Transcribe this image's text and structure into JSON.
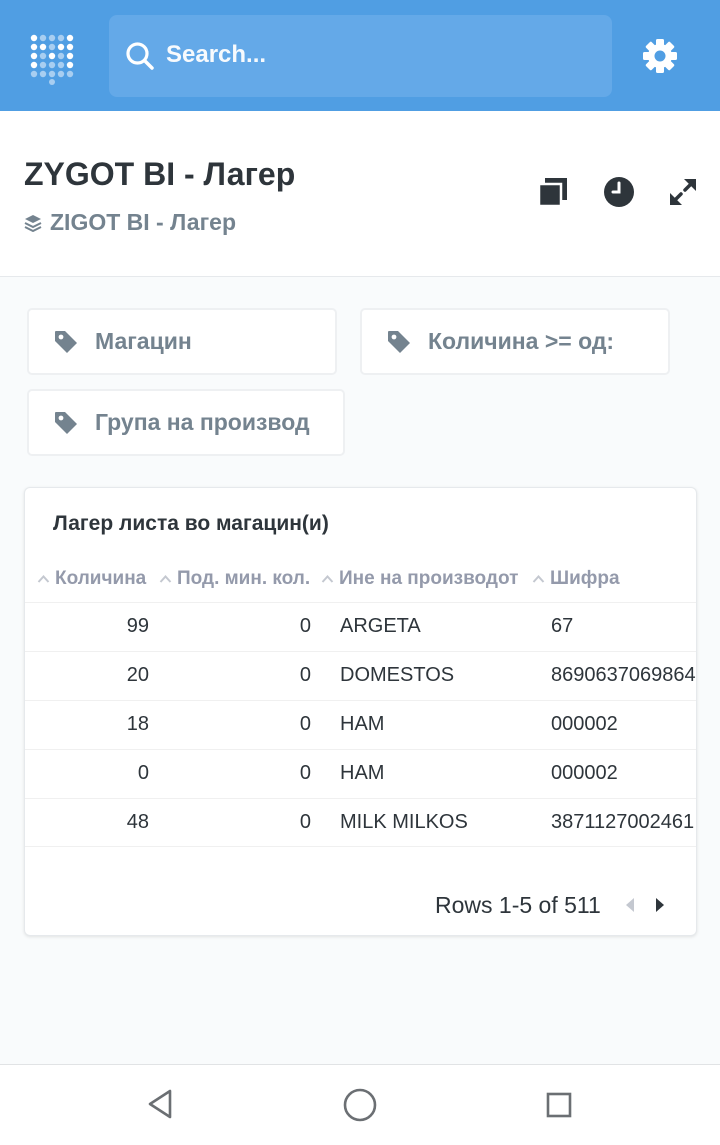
{
  "topbar": {
    "search_placeholder": "Search...",
    "icons": {
      "logo": "metabase-logo-icon",
      "search": "search-icon",
      "settings": "gear-icon"
    }
  },
  "header": {
    "title": "ZYGOT BI - Лагер",
    "breadcrumb": "ZIGOT BI - Лагер",
    "icons": [
      "copy-icon",
      "clock-icon",
      "expand-icon"
    ]
  },
  "filters": [
    {
      "label": "Магацин"
    },
    {
      "label": "Количина >= од:"
    },
    {
      "label": "Група на производ"
    }
  ],
  "table": {
    "title": "Лагер листа во магацин(и)",
    "columns": [
      "Количина",
      "Под. мин. кол.",
      "Ине на производот",
      "Шифра"
    ],
    "rows": [
      [
        "99",
        "0",
        "ARGETA",
        "67"
      ],
      [
        "20",
        "0",
        "DOMESTOS",
        "8690637069864"
      ],
      [
        "18",
        "0",
        "HAM",
        "000002"
      ],
      [
        "0",
        "0",
        "HAM",
        "000002"
      ],
      [
        "48",
        "0",
        "MILK MILKOS",
        "3871127002461"
      ]
    ],
    "pagination": "Rows 1-5 of 511"
  },
  "colors": {
    "brand": "#509ee3",
    "text": "#2e353b",
    "muted": "#74838f"
  }
}
